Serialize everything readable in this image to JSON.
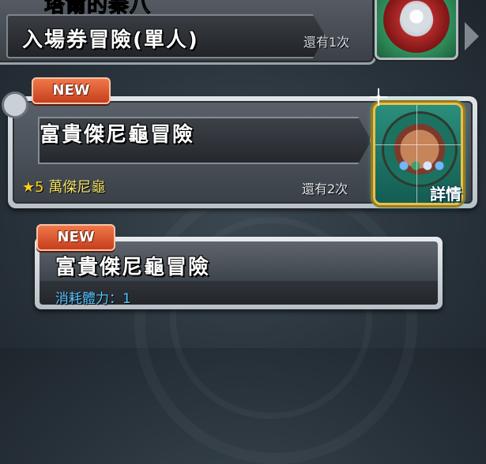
{
  "quest_list": {
    "items": [
      {
        "partial_title": "塔爾的秦八",
        "title": "入場券冒險(單人)",
        "remaining": "還有1次",
        "is_new": false
      },
      {
        "title": "富貴傑尼龜冒險",
        "is_new": true,
        "new_label": "NEW",
        "reward_star": "★5",
        "reward_monster": "萬傑尼龜",
        "remaining": "還有2次",
        "detail_label": "詳情"
      }
    ]
  },
  "stage_list": {
    "items": [
      {
        "title": "富貴傑尼龜冒險",
        "is_new": true,
        "new_label": "NEW",
        "stamina_text": "消耗體力：1"
      }
    ]
  },
  "colors": {
    "new_badge": "#d9532c",
    "reward_text": "#f3e46a",
    "stamina_text": "#58c6ff",
    "thumb_border": "#e7c24a"
  },
  "icons": {
    "card1_thumb": "monster-portrait-red-green",
    "card2_thumb": "monster-portrait-turtle",
    "sparkle": "sparkle-icon",
    "corner_bolt": "bolt-icon"
  }
}
